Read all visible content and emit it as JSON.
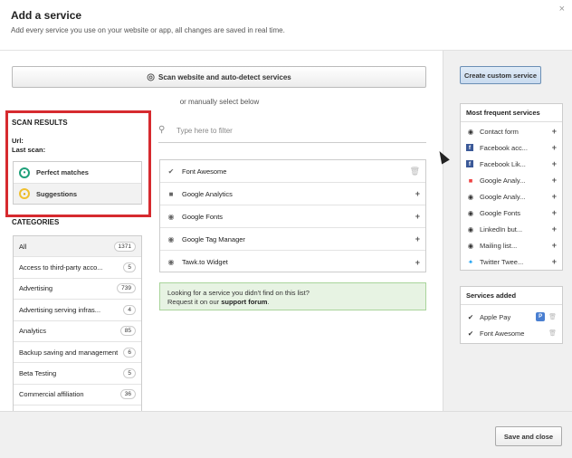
{
  "dialog": {
    "title": "Add a service",
    "subtitle": "Add every service you use on your website or app, all changes are saved in real time.",
    "close": "×"
  },
  "scan_button": {
    "label": "Scan website and auto-detect services"
  },
  "manual_text": "or manually select below",
  "scan_results": {
    "title": "SCAN RESULTS",
    "url_label": "Url:",
    "last_scan_label": "Last scan:",
    "perfect_label": "Perfect matches",
    "suggestions_label": "Suggestions"
  },
  "categories": {
    "title": "CATEGORIES",
    "items": [
      {
        "label": "All",
        "count": "1371"
      },
      {
        "label": "Access to third-party acco...",
        "count": "5"
      },
      {
        "label": "Advertising",
        "count": "739"
      },
      {
        "label": "Advertising serving infras...",
        "count": "4"
      },
      {
        "label": "Analytics",
        "count": "85"
      },
      {
        "label": "Backup saving and management",
        "count": "6"
      },
      {
        "label": "Beta Testing",
        "count": "5"
      },
      {
        "label": "Commercial affiliation",
        "count": "36"
      }
    ]
  },
  "filter": {
    "placeholder": "Type here to filter"
  },
  "services": [
    {
      "name": "Font Awesome",
      "action": "trash"
    },
    {
      "name": "Google Analytics",
      "action": "+"
    },
    {
      "name": "Google Fonts",
      "action": "+"
    },
    {
      "name": "Google Tag Manager",
      "action": "+"
    },
    {
      "name": "Tawk.to Widget",
      "action": "+"
    }
  ],
  "notice": {
    "line1": "Looking for a service you didn't find on this list?",
    "line2_prefix": "Request it on our ",
    "link": "support forum",
    "line2_suffix": "."
  },
  "custom_button": {
    "label": "Create custom service"
  },
  "frequent": {
    "title": "Most frequent services",
    "items": [
      {
        "name": "Contact form",
        "icon": "circle"
      },
      {
        "name": "Facebook acc...",
        "icon": "facebook"
      },
      {
        "name": "Facebook Lik...",
        "icon": "facebook"
      },
      {
        "name": "Google Analy...",
        "icon": "google"
      },
      {
        "name": "Google Analy...",
        "icon": "circle"
      },
      {
        "name": "Google Fonts",
        "icon": "circle"
      },
      {
        "name": "LinkedIn but...",
        "icon": "circle"
      },
      {
        "name": "Mailing list...",
        "icon": "circle"
      },
      {
        "name": "Twitter Twee...",
        "icon": "twitter"
      }
    ]
  },
  "added": {
    "title": "Services added",
    "items": [
      {
        "name": "Apple Pay",
        "badge": "P"
      },
      {
        "name": "Font Awesome",
        "badge": ""
      }
    ]
  },
  "footer": {
    "save_label": "Save and close"
  }
}
